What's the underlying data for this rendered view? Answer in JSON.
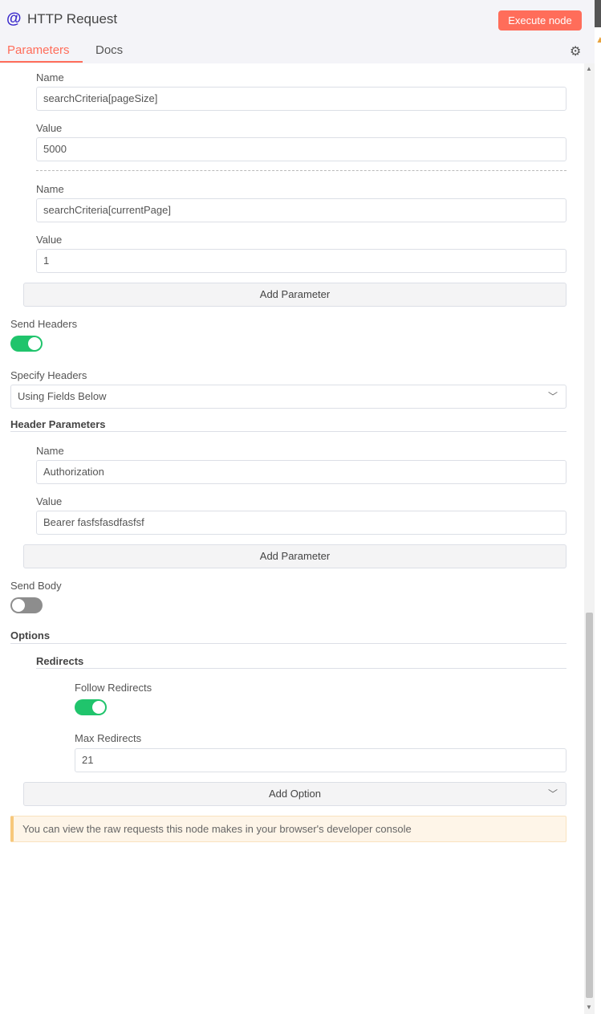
{
  "header": {
    "title": "HTTP Request",
    "execute_label": "Execute node",
    "tabs": [
      "Parameters",
      "Docs"
    ],
    "active_tab": "Parameters",
    "node_icon": "at-icon",
    "settings_icon": "gear-icon"
  },
  "query_params": [
    {
      "name_label": "Name",
      "name_value": "searchCriteria[pageSize]",
      "value_label": "Value",
      "value_value": "5000"
    },
    {
      "name_label": "Name",
      "name_value": "searchCriteria[currentPage]",
      "value_label": "Value",
      "value_value": "1"
    }
  ],
  "add_parameter_label": "Add Parameter",
  "send_headers": {
    "label": "Send Headers",
    "enabled": true
  },
  "specify_headers": {
    "label": "Specify Headers",
    "selected": "Using Fields Below"
  },
  "header_parameters": {
    "title": "Header Parameters",
    "items": [
      {
        "name_label": "Name",
        "name_value": "Authorization",
        "value_label": "Value",
        "value_value": "Bearer fasfsfasdfasfsf"
      }
    ]
  },
  "send_body": {
    "label": "Send Body",
    "enabled": false
  },
  "options": {
    "title": "Options",
    "redirects": {
      "title": "Redirects",
      "follow_label": "Follow Redirects",
      "follow_enabled": true,
      "max_label": "Max Redirects",
      "max_value": "21"
    },
    "add_option_label": "Add Option"
  },
  "notice": "You can view the raw requests this node makes in your browser's developer console",
  "colors": {
    "accent": "#ff6d5a",
    "toggle_on": "#20c46c",
    "toggle_off": "#8d8d8d",
    "node_icon": "#3b2acb"
  }
}
